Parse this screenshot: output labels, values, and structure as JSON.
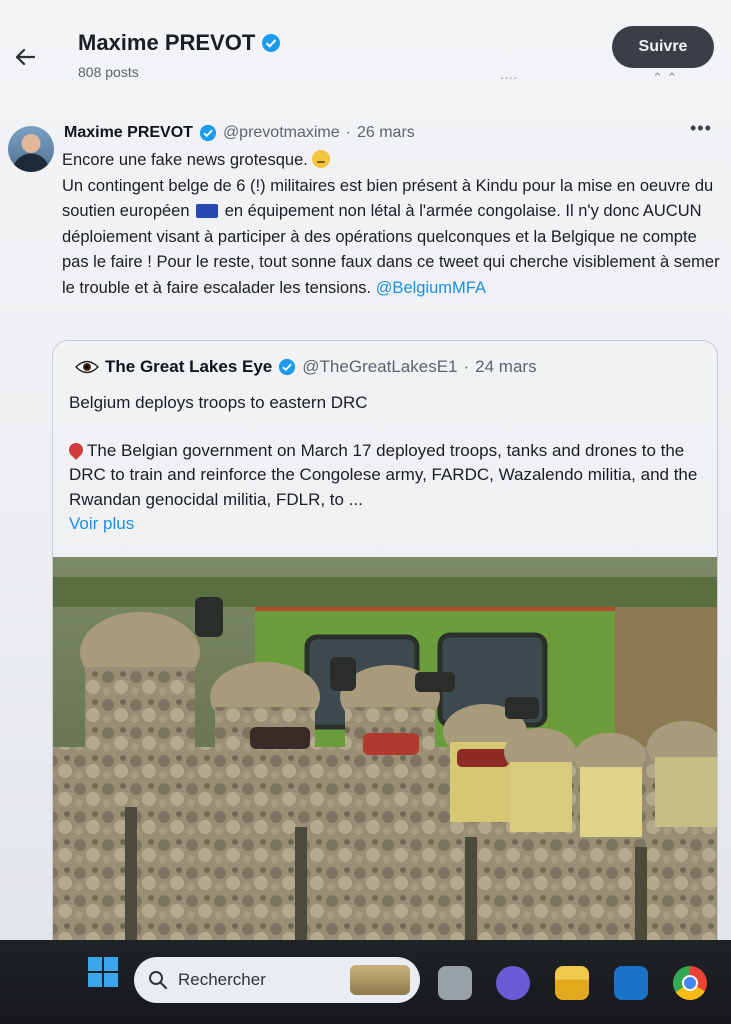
{
  "header": {
    "name": "Maxime PREVOT",
    "posts": "808 posts",
    "follow_label": "Suivre"
  },
  "tweet": {
    "name": "Maxime PREVOT",
    "handle": "@prevotmaxime",
    "separator": "·",
    "date": "26 mars",
    "line1": "Encore une fake news grotesque.",
    "body_part1": "Un contingent belge de 6 (!) militaires est bien présent à Kindu pour la mise en oeuvre du soutien européen",
    "body_part2": "en équipement non létal à l'armée congolaise. Il n'y donc AUCUN déploiement visant à participer à des opérations quelconques et la Belgique ne compte pas le faire ! Pour le reste, tout sonne faux dans ce tweet qui cherche visiblement à semer le trouble et à faire escalader les tensions.",
    "mention": "@BelgiumMFA"
  },
  "quote": {
    "name": "The Great Lakes Eye",
    "handle": "@TheGreatLakesE1",
    "separator": "·",
    "date": "24 mars",
    "title": "Belgium deploys troops to eastern DRC",
    "body": "The Belgian government on March 17 deployed troops, tanks and drones to the DRC to train and reinforce the Congolese army, FARDC, Wazalendo militia, and the Rwandan genocidal militia, FDLR, to ...",
    "more_label": "Voir plus"
  },
  "taskbar": {
    "search_label": "Rechercher"
  },
  "colors": {
    "link": "#1d8fe0",
    "verified": "#1d9bf0",
    "follow_bg": "#3a3f46"
  },
  "icons": [
    "back-arrow-icon",
    "verified-badge-icon",
    "more-icon",
    "eye-icon",
    "pin-icon",
    "eu-flag-icon",
    "windows-start-icon",
    "search-icon",
    "file-explorer-icon",
    "outlook-icon",
    "chrome-icon",
    "meet-icon"
  ]
}
